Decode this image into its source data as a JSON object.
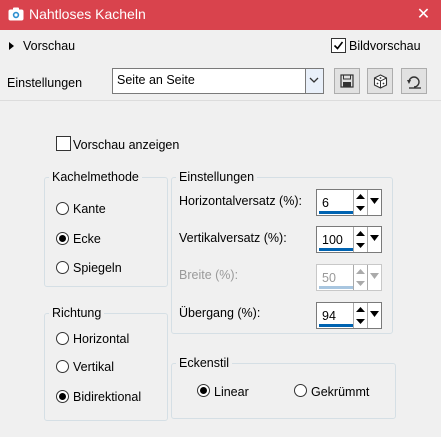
{
  "window": {
    "title": "Nahtloses Kacheln",
    "close_glyph": "✕"
  },
  "preview": {
    "label": "Vorschau",
    "image_preview_label": "Bildvorschau",
    "image_preview_checked": true
  },
  "settings": {
    "label": "Einstellungen",
    "preset_value": "Seite an Seite"
  },
  "show_preview": {
    "label": "Vorschau anzeigen",
    "checked": false
  },
  "tile_method": {
    "label": "Kachelmethode",
    "options": [
      "Kante",
      "Ecke",
      "Spiegeln"
    ],
    "selected": "Ecke"
  },
  "direction": {
    "label": "Richtung",
    "options": [
      "Horizontal",
      "Vertikal",
      "Bidirektional"
    ],
    "selected": "Bidirektional"
  },
  "params": {
    "label": "Einstellungen",
    "horizontal_offset": {
      "label": "Horizontalversatz (%):",
      "value": "6"
    },
    "vertical_offset": {
      "label": "Vertikalversatz (%):",
      "value": "100"
    },
    "width": {
      "label": "Breite (%):",
      "value": "50"
    },
    "transition": {
      "label": "Übergang (%):",
      "value": "94"
    }
  },
  "corner_style": {
    "label": "Eckenstil",
    "options": [
      "Linear",
      "Gekrümmt"
    ],
    "selected": "Linear"
  },
  "colors": {
    "titlebar": "#d9434d",
    "accent": "#0063b1"
  }
}
